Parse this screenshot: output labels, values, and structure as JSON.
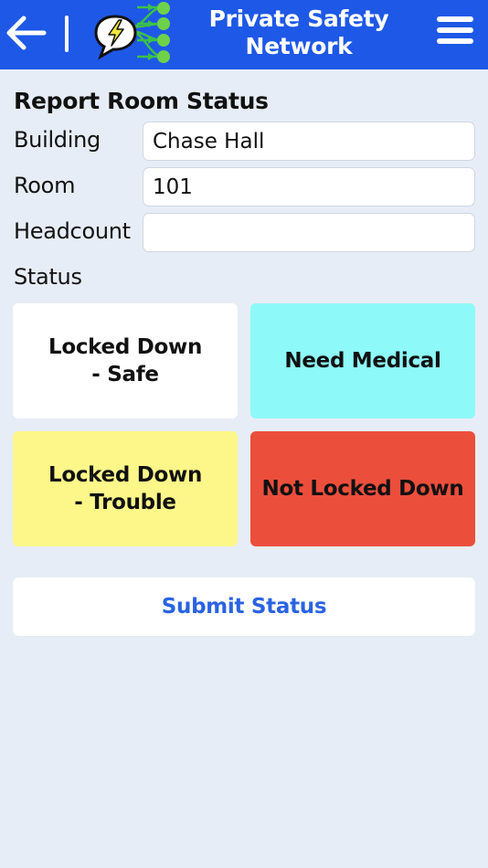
{
  "header": {
    "title": "Private Safety Network",
    "back_icon": "arrow-left-icon",
    "logo_icon": "lightning-bubble-network-logo",
    "menu_icon": "hamburger-menu-icon"
  },
  "form": {
    "section_title": "Report Room Status",
    "building": {
      "label": "Building",
      "value": "Chase Hall"
    },
    "room": {
      "label": "Room",
      "value": "101"
    },
    "headcount": {
      "label": "Headcount",
      "value": ""
    },
    "status_label": "Status"
  },
  "status_options": [
    {
      "label": "Locked Down\n- Safe",
      "color": "#ffffff"
    },
    {
      "label": "Need Medical",
      "color": "#8ef9f9"
    },
    {
      "label": "Locked Down\n- Trouble",
      "color": "#fdf78a"
    },
    {
      "label": "Not Locked Down",
      "color": "#ec4e3c"
    }
  ],
  "submit_label": "Submit Status",
  "colors": {
    "header_bg": "#1e58e6",
    "page_bg": "#e7edf6",
    "submit_text": "#2a63e2"
  }
}
